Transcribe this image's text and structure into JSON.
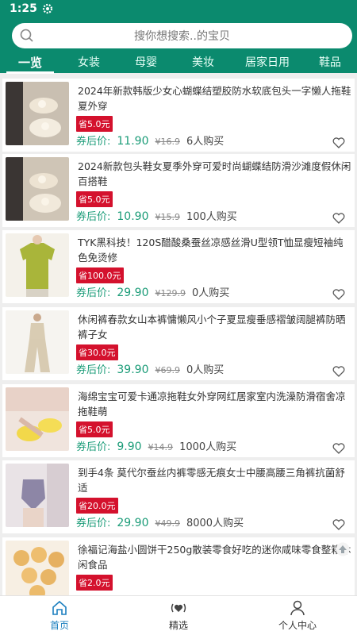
{
  "status": {
    "time": "1:25"
  },
  "search": {
    "placeholder": "搜你想搜索..的宝贝"
  },
  "tabs": [
    "一览",
    "女装",
    "母婴",
    "美妆",
    "居家日用",
    "鞋品"
  ],
  "items": [
    {
      "title": "2024年新款韩版少女心蝴蝶结塑胶防水软底包头一字懒人拖鞋夏外穿",
      "badge": "省5.0元",
      "price_label": "券后价:",
      "price": "11.90",
      "orig": "¥16.9",
      "sold": "6人购买"
    },
    {
      "title": "2024新款包头鞋女夏季外穿可爱时尚蝴蝶结防滑沙滩度假休闲百搭鞋",
      "badge": "省5.0元",
      "price_label": "券后价:",
      "price": "10.90",
      "orig": "¥15.9",
      "sold": "100人购买"
    },
    {
      "title": "TYK黑科技！120S醋酸桑蚕丝凉感丝滑U型领T恤显瘦短袖纯色免烫修",
      "badge": "省100.0元",
      "price_label": "券后价:",
      "price": "29.90",
      "orig": "¥129.9",
      "sold": "0人购买"
    },
    {
      "title": "休闲裤春款女山本裤慵懒风小个子夏显瘦垂感褶皱阔腿裤防晒裤子女",
      "badge": "省30.0元",
      "price_label": "券后价:",
      "price": "39.90",
      "orig": "¥69.9",
      "sold": "0人购买"
    },
    {
      "title": "海绵宝宝可爱卡通凉拖鞋女外穿网红居家室内洗澡防滑宿舍凉拖鞋萌",
      "badge": "省5.0元",
      "price_label": "券后价:",
      "price": "9.90",
      "orig": "¥14.9",
      "sold": "1000人购买"
    },
    {
      "title": "到手4条 莫代尔蚕丝内裤零感无痕女士中腰高腰三角裤抗菌舒适",
      "badge": "省20.0元",
      "price_label": "券后价:",
      "price": "29.90",
      "orig": "¥49.9",
      "sold": "8000人购买"
    },
    {
      "title": "徐福记海盐小圆饼干250g散装零食好吃的迷你咸味零食整箱休闲食品",
      "badge": "省2.0元",
      "price_label": "",
      "price": "",
      "orig": "",
      "sold": ""
    }
  ],
  "bottom_nav": [
    {
      "label": "首页",
      "icon": "home-icon"
    },
    {
      "label": "精选",
      "icon": "featured-icon"
    },
    {
      "label": "个人中心",
      "icon": "user-icon"
    }
  ],
  "colors": {
    "brand": "#0b8a6e",
    "price": "#1b9c78",
    "badge": "#d4112d",
    "nav_active": "#1b7fbf"
  }
}
